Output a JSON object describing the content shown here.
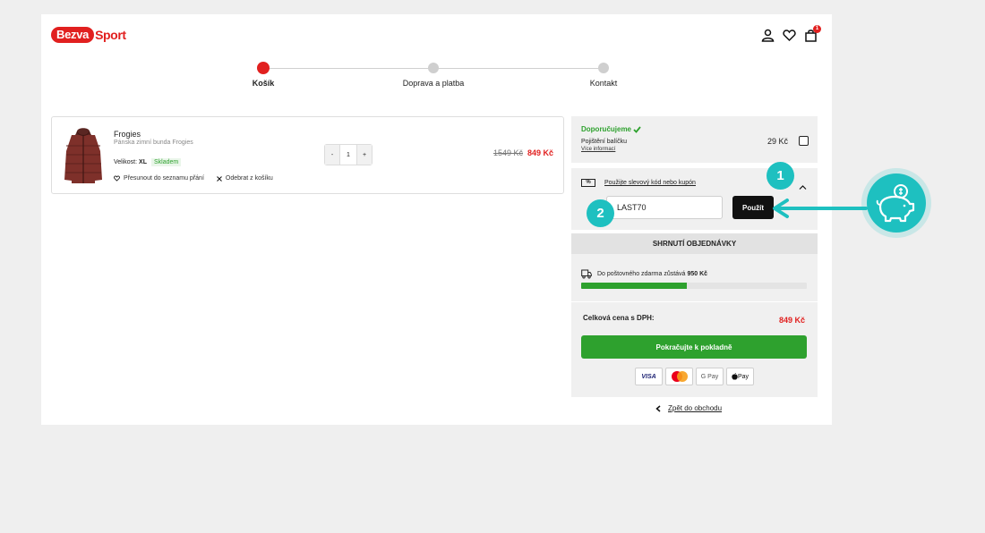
{
  "brand": {
    "part1": "Bezva",
    "part2": "Sport",
    "color": "#e1201f"
  },
  "header": {
    "cart_count": "1"
  },
  "steps": [
    {
      "label": "Košík",
      "active": true
    },
    {
      "label": "Doprava a platba",
      "active": false
    },
    {
      "label": "Kontakt",
      "active": false
    }
  ],
  "product": {
    "name": "Frogies",
    "subtitle": "Pánska zimní bunda Frogies",
    "size_label": "Velikost:",
    "size_value": "XL",
    "stock": "Skladem",
    "wishlist": "Přesunout do seznamu přání",
    "remove": "Odebrat z košíku",
    "qty_minus": "-",
    "qty_value": "1",
    "qty_plus": "+",
    "old_price": "1549 Kč",
    "new_price": "849 Kč"
  },
  "recommend": {
    "title": "Doporučujeme",
    "insurance": "Pojištění balíčku",
    "more": "Více informací",
    "price": "29 Kč"
  },
  "coupon": {
    "icon": "%",
    "link": "Použijte slevový kód nebo kupón",
    "value": "LAST70",
    "apply": "Použít"
  },
  "summary": {
    "title": "SHRNUTÍ OBJEDNÁVKY",
    "shipping_text": "Do poštovného zdarma zůstává",
    "shipping_amount": "950 Kč",
    "shipping_progress": 0.47,
    "total_label": "Celková cena s DPH:",
    "total_value": "849 Kč",
    "checkout": "Pokračujte k pokladně",
    "payments": [
      "VISA",
      "mastercard",
      "G Pay",
      "Pay"
    ]
  },
  "back": "Zpět do obchodu",
  "annotations": {
    "badge1": "1",
    "badge2": "2",
    "accent": "#1ec0c0"
  }
}
